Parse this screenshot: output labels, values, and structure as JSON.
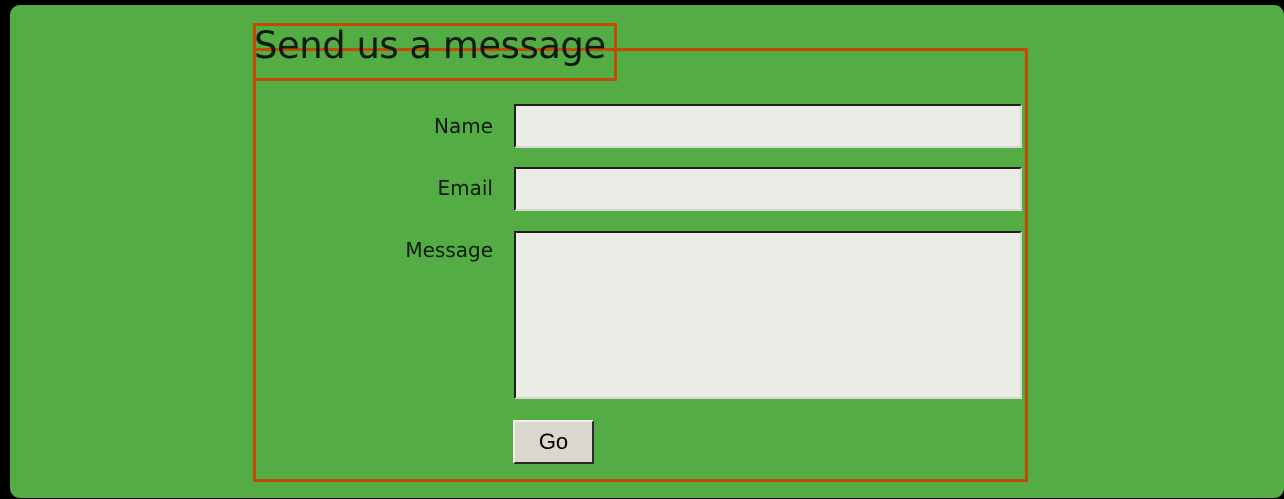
{
  "form": {
    "heading": "Send us a message",
    "fields": {
      "name": {
        "label": "Name",
        "value": "",
        "placeholder": ""
      },
      "email": {
        "label": "Email",
        "value": "",
        "placeholder": ""
      },
      "message": {
        "label": "Message",
        "value": "",
        "placeholder": ""
      }
    },
    "submit_label": "Go"
  },
  "colors": {
    "page_background": "#000000",
    "panel_background": "#53ad44",
    "highlight_outline": "#c24a05",
    "input_background": "#ecece6",
    "button_background": "#dcd7cc"
  }
}
